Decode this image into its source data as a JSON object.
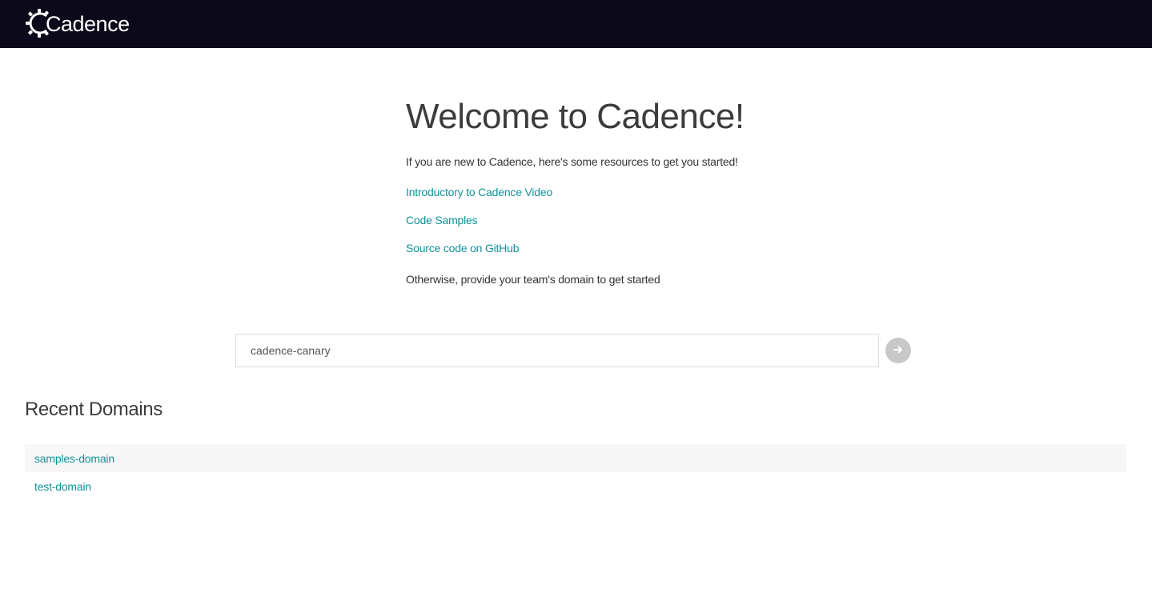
{
  "header": {
    "logo_text": "Cadence",
    "background": "#0b0919"
  },
  "intro": {
    "title": "Welcome to Cadence!",
    "lead": "If you are new to Cadence, here's some resources to get you started!",
    "links": [
      {
        "label": "Introductory to Cadence Video"
      },
      {
        "label": "Code Samples"
      },
      {
        "label": "Source code on GitHub"
      }
    ],
    "outro": "Otherwise, provide your team's domain to get started"
  },
  "search": {
    "value": "cadence-canary",
    "button_icon": "arrow-right-icon"
  },
  "recent": {
    "title": "Recent Domains",
    "items": [
      {
        "label": "samples-domain"
      },
      {
        "label": "test-domain"
      }
    ]
  },
  "colors": {
    "link": "#11939a",
    "button": "#c8c8c8",
    "row_alt": "#f7f7f7"
  }
}
